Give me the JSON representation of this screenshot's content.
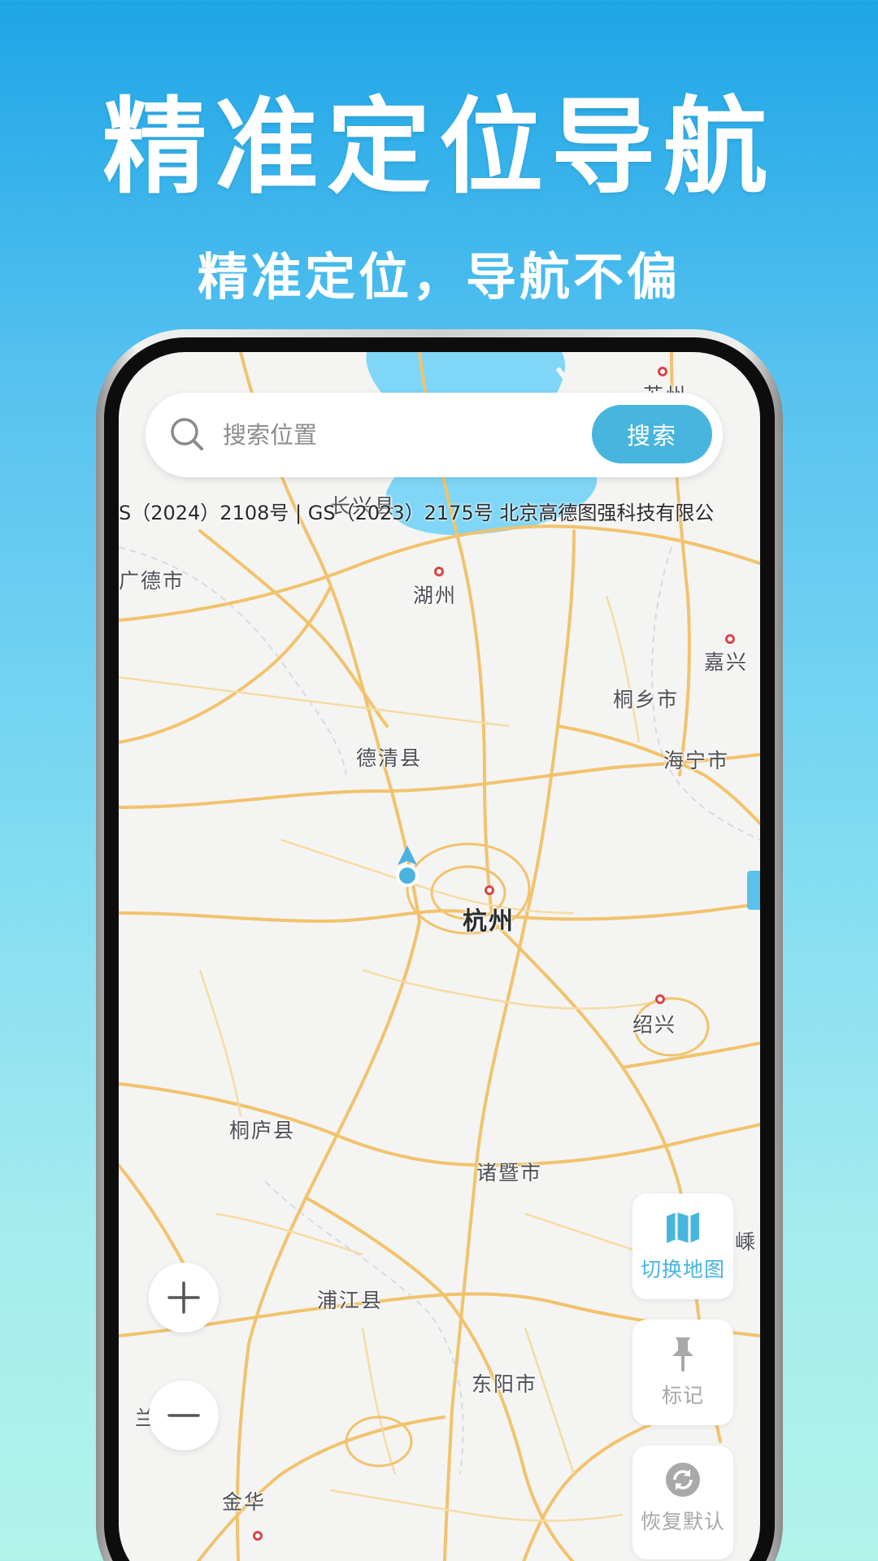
{
  "promo": {
    "headline": "精准定位导航",
    "subline": "精准定位，导航不偏"
  },
  "search": {
    "placeholder": "搜索位置",
    "button_label": "搜索"
  },
  "attribution": "S（2024）2108号 | GS（2023）2175号 北京高德图强科技有限公",
  "map": {
    "cities": {
      "suzhou": "苏州",
      "changxing": "长兴县",
      "guangde": "广德市",
      "huzhou": "湖州",
      "jiaxing": "嘉兴",
      "tongxiang": "桐乡市",
      "deqing": "德清县",
      "haining": "海宁市",
      "hangzhou": "杭州",
      "shaoxing": "绍兴",
      "tonglu": "桐庐县",
      "zhuji": "诸暨市",
      "sheng": "嵊",
      "pujiang": "浦江县",
      "dongyang": "东阳市",
      "lanxi": "兰溪市",
      "jinhua": "金华"
    }
  },
  "side_buttons": {
    "switch_map": "切换地图",
    "mark": "标记",
    "reset": "恢复默认"
  },
  "colors": {
    "accent": "#47b5de",
    "road": "#f1c36d",
    "water": "#7fd6f7",
    "map_bg": "#f4f4f2"
  }
}
